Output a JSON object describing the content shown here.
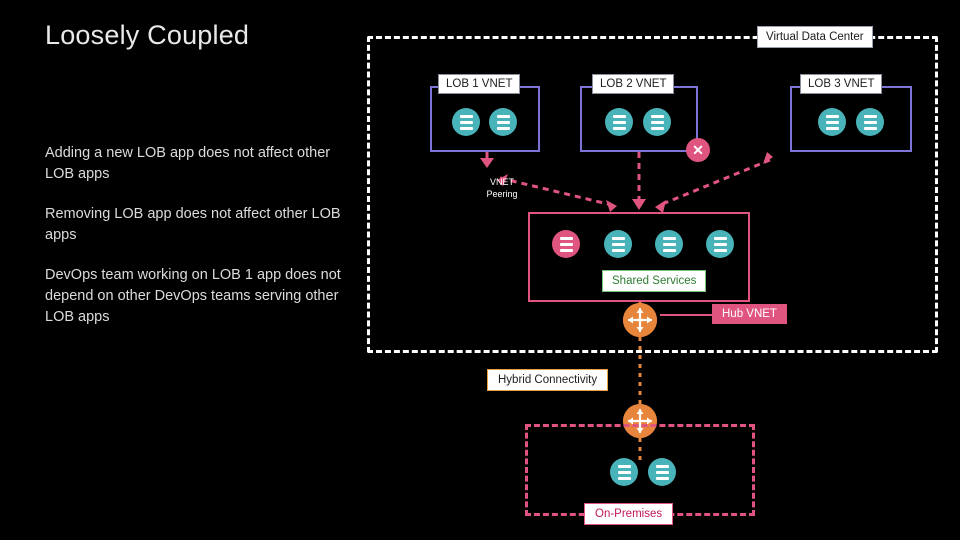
{
  "title": "Loosely Coupled",
  "paragraphs": [
    "Adding a new LOB app does not affect other LOB apps",
    "Removing LOB app does not affect other LOB apps",
    "DevOps team working on LOB 1 app does not depend on other DevOps teams serving other LOB apps"
  ],
  "labels": {
    "virtual_data_center": "Virtual Data Center",
    "lob1": "LOB 1 VNET",
    "lob2": "LOB 2 VNET",
    "lob3": "LOB 3 VNET",
    "vnet_peering": "VNET\nPeering",
    "vnet_peering_line1": "VNET",
    "vnet_peering_line2": "Peering",
    "shared_services": "Shared Services",
    "hub_vnet": "Hub VNET",
    "hybrid_connectivity": "Hybrid Connectivity",
    "on_premises": "On-Premises",
    "x_mark": "✕"
  },
  "colors": {
    "background": "#000000",
    "lob_border": "#7e74d8",
    "hub_border": "#e0557f",
    "server_icon": "#48b3b8",
    "server_icon_alt": "#e0557f",
    "gateway": "#e8853d",
    "dashed_white": "#ffffff",
    "shared_services_text": "#2e7d32",
    "on_prem_text": "#c2185b"
  },
  "icons": {
    "server": "server-icon",
    "gateway": "gateway-cross-icon",
    "block": "block-x-icon"
  }
}
